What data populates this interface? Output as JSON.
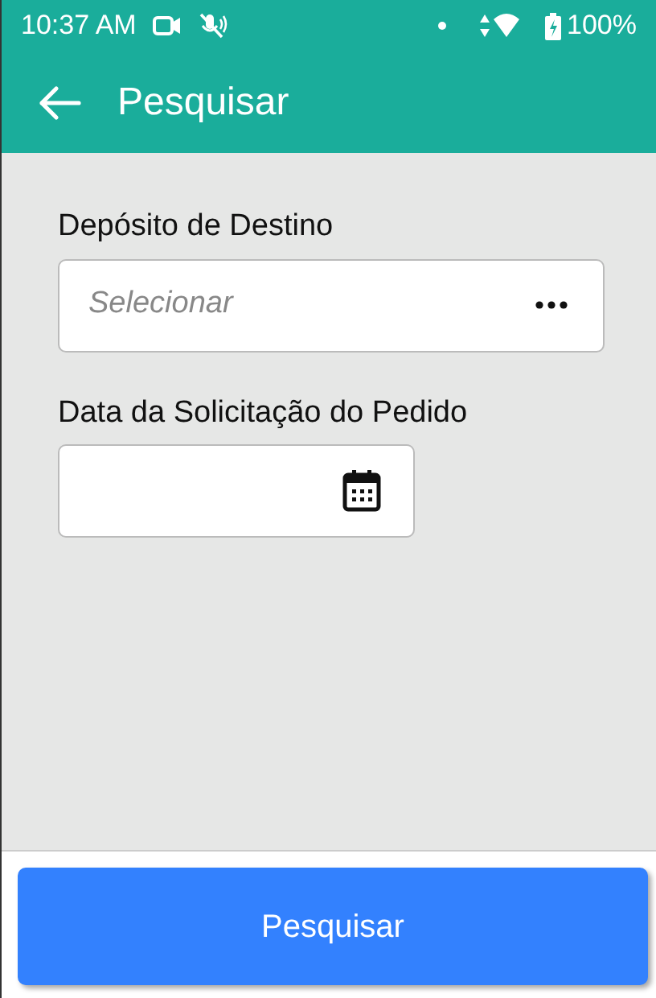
{
  "status_bar": {
    "time": "10:37 AM",
    "battery": "100%"
  },
  "app_bar": {
    "title": "Pesquisar"
  },
  "fields": [
    {
      "kind": "picker",
      "label": "Depósito de Destino",
      "placeholder": "Selecionar"
    },
    {
      "kind": "date",
      "label": "Data da Solicitação do Pedido"
    }
  ],
  "submit_button": {
    "label": "Pesquisar"
  }
}
